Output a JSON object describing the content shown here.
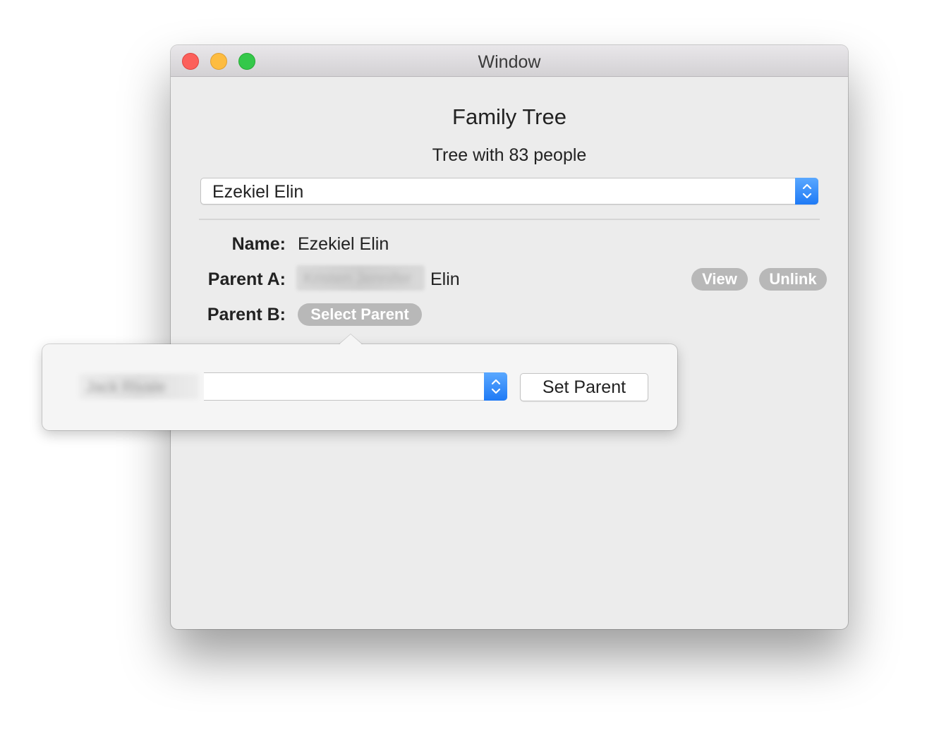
{
  "window": {
    "title": "Window",
    "colors": {
      "close": "#fc605b",
      "minimize": "#fdbc40",
      "maximize": "#34c84a"
    }
  },
  "header": {
    "title": "Family Tree",
    "subtitle": "Tree with 83 people"
  },
  "person_select": {
    "selected": "Ezekiel Elin",
    "icon": "chevron-up-down-icon"
  },
  "details": {
    "name_label": "Name:",
    "name_value": "Ezekiel Elin",
    "parent_a_label": "Parent A:",
    "parent_a_first": "Kristen Jennifer",
    "parent_a_last": "Elin",
    "view_label": "View",
    "unlink_label": "Unlink",
    "parent_b_label": "Parent B:",
    "select_parent_label": "Select Parent"
  },
  "popover": {
    "blurred_label": "Jack Rivale",
    "parent_select_value": "",
    "set_parent_label": "Set Parent",
    "accent_color": "#1f7af5"
  }
}
